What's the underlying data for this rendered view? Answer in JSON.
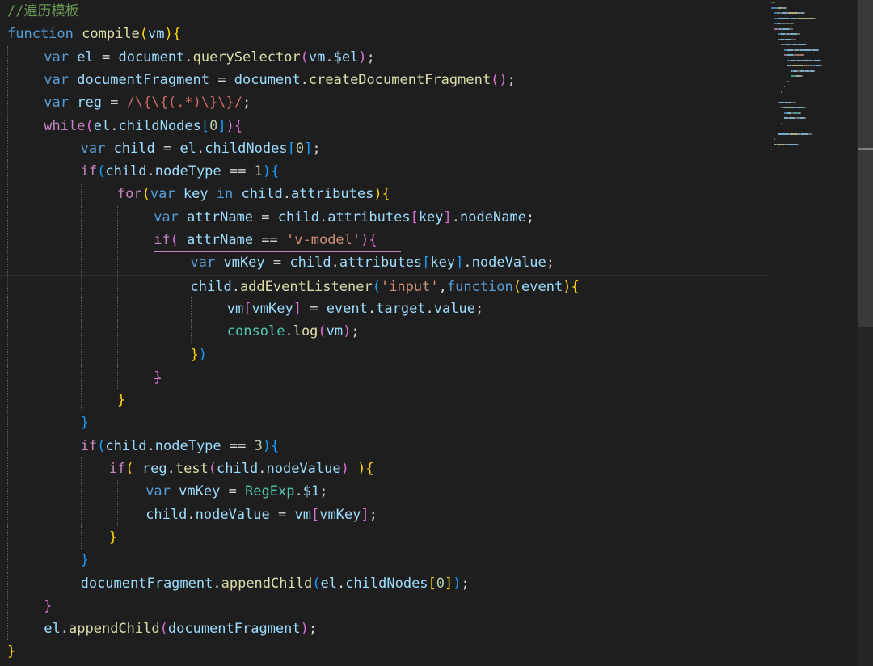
{
  "editor": {
    "lines": [
      {
        "indent": 0,
        "tokens": [
          [
            "c-comment",
            "//遍历模板"
          ]
        ]
      },
      {
        "indent": 0,
        "tokens": [
          [
            "c-keyword",
            "function"
          ],
          [
            "c-plain",
            " "
          ],
          [
            "c-func",
            "compile"
          ],
          [
            "b1",
            "("
          ],
          [
            "c-var",
            "vm"
          ],
          [
            "b1",
            ")"
          ],
          [
            "b1",
            "{"
          ]
        ]
      },
      {
        "indent": 1,
        "tokens": [
          [
            "c-keyword",
            "var"
          ],
          [
            "c-plain",
            " "
          ],
          [
            "c-var",
            "el"
          ],
          [
            "c-plain",
            " = "
          ],
          [
            "c-var",
            "document"
          ],
          [
            "c-plain",
            "."
          ],
          [
            "c-func",
            "querySelector"
          ],
          [
            "b2",
            "("
          ],
          [
            "c-var",
            "vm"
          ],
          [
            "c-plain",
            "."
          ],
          [
            "c-var",
            "$el"
          ],
          [
            "b2",
            ")"
          ],
          [
            "c-plain",
            ";"
          ]
        ]
      },
      {
        "indent": 1,
        "tokens": [
          [
            "c-keyword",
            "var"
          ],
          [
            "c-plain",
            " "
          ],
          [
            "c-var",
            "documentFragment"
          ],
          [
            "c-plain",
            " = "
          ],
          [
            "c-var",
            "document"
          ],
          [
            "c-plain",
            "."
          ],
          [
            "c-func",
            "createDocumentFragment"
          ],
          [
            "b2",
            "("
          ],
          [
            "b2",
            ")"
          ],
          [
            "c-plain",
            ";"
          ]
        ]
      },
      {
        "indent": 1,
        "tokens": [
          [
            "c-keyword",
            "var"
          ],
          [
            "c-plain",
            " "
          ],
          [
            "c-var",
            "reg"
          ],
          [
            "c-plain",
            " = "
          ],
          [
            "c-regex",
            "/\\{\\{(.*)\\}\\}/"
          ],
          [
            "c-plain",
            ";"
          ]
        ]
      },
      {
        "indent": 1,
        "tokens": [
          [
            "c-control",
            "while"
          ],
          [
            "b2",
            "("
          ],
          [
            "c-var",
            "el"
          ],
          [
            "c-plain",
            "."
          ],
          [
            "c-var",
            "childNodes"
          ],
          [
            "b3",
            "["
          ],
          [
            "c-number",
            "0"
          ],
          [
            "b3",
            "]"
          ],
          [
            "b2",
            ")"
          ],
          [
            "b2",
            "{"
          ]
        ]
      },
      {
        "indent": 2,
        "tokens": [
          [
            "c-keyword",
            "var"
          ],
          [
            "c-plain",
            " "
          ],
          [
            "c-var",
            "child"
          ],
          [
            "c-plain",
            " = "
          ],
          [
            "c-var",
            "el"
          ],
          [
            "c-plain",
            "."
          ],
          [
            "c-var",
            "childNodes"
          ],
          [
            "b3",
            "["
          ],
          [
            "c-number",
            "0"
          ],
          [
            "b3",
            "]"
          ],
          [
            "c-plain",
            ";"
          ]
        ]
      },
      {
        "indent": 2,
        "tokens": [
          [
            "c-control",
            "if"
          ],
          [
            "b3",
            "("
          ],
          [
            "c-var",
            "child"
          ],
          [
            "c-plain",
            "."
          ],
          [
            "c-var",
            "nodeType"
          ],
          [
            "c-plain",
            " == "
          ],
          [
            "c-number",
            "1"
          ],
          [
            "b3",
            ")"
          ],
          [
            "b3",
            "{"
          ]
        ]
      },
      {
        "indent": 3,
        "tokens": [
          [
            "c-control",
            "for"
          ],
          [
            "b1",
            "("
          ],
          [
            "c-keyword",
            "var"
          ],
          [
            "c-plain",
            " "
          ],
          [
            "c-var",
            "key"
          ],
          [
            "c-plain",
            " "
          ],
          [
            "c-keyword",
            "in"
          ],
          [
            "c-plain",
            " "
          ],
          [
            "c-var",
            "child"
          ],
          [
            "c-plain",
            "."
          ],
          [
            "c-var",
            "attributes"
          ],
          [
            "b1",
            ")"
          ],
          [
            "b1",
            "{"
          ]
        ]
      },
      {
        "indent": 4,
        "tokens": [
          [
            "c-keyword",
            "var"
          ],
          [
            "c-plain",
            " "
          ],
          [
            "c-var",
            "attrName"
          ],
          [
            "c-plain",
            " = "
          ],
          [
            "c-var",
            "child"
          ],
          [
            "c-plain",
            "."
          ],
          [
            "c-var",
            "attributes"
          ],
          [
            "b2",
            "["
          ],
          [
            "c-var",
            "key"
          ],
          [
            "b2",
            "]"
          ],
          [
            "c-plain",
            "."
          ],
          [
            "c-var",
            "nodeName"
          ],
          [
            "c-plain",
            ";"
          ]
        ]
      },
      {
        "indent": 4,
        "tokens": [
          [
            "c-control",
            "if"
          ],
          [
            "b2",
            "("
          ],
          [
            "c-plain",
            " "
          ],
          [
            "c-var",
            "attrName"
          ],
          [
            "c-plain",
            " == "
          ],
          [
            "c-string",
            "'v-model'"
          ],
          [
            "b2",
            ")"
          ],
          [
            "b2",
            "{"
          ]
        ]
      },
      {
        "indent": 5,
        "tokens": [
          [
            "c-keyword",
            "var"
          ],
          [
            "c-plain",
            " "
          ],
          [
            "c-var",
            "vmKey"
          ],
          [
            "c-plain",
            " = "
          ],
          [
            "c-var",
            "child"
          ],
          [
            "c-plain",
            "."
          ],
          [
            "c-var",
            "attributes"
          ],
          [
            "b3",
            "["
          ],
          [
            "c-var",
            "key"
          ],
          [
            "b3",
            "]"
          ],
          [
            "c-plain",
            "."
          ],
          [
            "c-var",
            "nodeValue"
          ],
          [
            "c-plain",
            ";"
          ]
        ]
      },
      {
        "indent": 5,
        "current": true,
        "tokens": [
          [
            "c-var",
            "child"
          ],
          [
            "c-plain",
            "."
          ],
          [
            "c-func",
            "addEventListener"
          ],
          [
            "b3",
            "("
          ],
          [
            "c-string",
            "'input'"
          ],
          [
            "c-plain",
            ","
          ],
          [
            "c-keyword",
            "function"
          ],
          [
            "b1",
            "("
          ],
          [
            "c-var",
            "event"
          ],
          [
            "b1",
            ")"
          ],
          [
            "b1",
            "{"
          ]
        ]
      },
      {
        "indent": 6,
        "tokens": [
          [
            "c-var",
            "vm"
          ],
          [
            "b2",
            "["
          ],
          [
            "c-var",
            "vmKey"
          ],
          [
            "b2",
            "]"
          ],
          [
            "c-plain",
            " = "
          ],
          [
            "c-var",
            "event"
          ],
          [
            "c-plain",
            "."
          ],
          [
            "c-var",
            "target"
          ],
          [
            "c-plain",
            "."
          ],
          [
            "c-var",
            "value"
          ],
          [
            "c-plain",
            ";"
          ]
        ]
      },
      {
        "indent": 6,
        "tokens": [
          [
            "c-class",
            "console"
          ],
          [
            "c-plain",
            "."
          ],
          [
            "c-func",
            "log"
          ],
          [
            "b2",
            "("
          ],
          [
            "c-var",
            "vm"
          ],
          [
            "b2",
            ")"
          ],
          [
            "c-plain",
            ";"
          ]
        ]
      },
      {
        "indent": 5,
        "tokens": [
          [
            "b1",
            "}"
          ],
          [
            "b3",
            ")"
          ]
        ]
      },
      {
        "indent": 4,
        "tokens": [
          [
            "b2",
            "}"
          ]
        ]
      },
      {
        "indent": 3,
        "tokens": [
          [
            "b1",
            "}"
          ]
        ]
      },
      {
        "indent": 2,
        "tokens": [
          [
            "b3",
            "}"
          ]
        ]
      },
      {
        "indent": 2,
        "tokens": [
          [
            "c-control",
            "if"
          ],
          [
            "b3",
            "("
          ],
          [
            "c-var",
            "child"
          ],
          [
            "c-plain",
            "."
          ],
          [
            "c-var",
            "nodeType"
          ],
          [
            "c-plain",
            " == "
          ],
          [
            "c-number",
            "3"
          ],
          [
            "b3",
            ")"
          ],
          [
            "b3",
            "{"
          ]
        ]
      },
      {
        "indent": 3,
        "offset": -10,
        "tokens": [
          [
            "c-control",
            "if"
          ],
          [
            "b1",
            "("
          ],
          [
            "c-plain",
            " "
          ],
          [
            "c-var",
            "reg"
          ],
          [
            "c-plain",
            "."
          ],
          [
            "c-func",
            "test"
          ],
          [
            "b2",
            "("
          ],
          [
            "c-var",
            "child"
          ],
          [
            "c-plain",
            "."
          ],
          [
            "c-var",
            "nodeValue"
          ],
          [
            "b2",
            ")"
          ],
          [
            "c-plain",
            " "
          ],
          [
            "b1",
            ")"
          ],
          [
            "b1",
            "{"
          ]
        ]
      },
      {
        "indent": 4,
        "offset": -10,
        "tokens": [
          [
            "c-keyword",
            "var"
          ],
          [
            "c-plain",
            " "
          ],
          [
            "c-var",
            "vmKey"
          ],
          [
            "c-plain",
            " = "
          ],
          [
            "c-class",
            "RegExp"
          ],
          [
            "c-plain",
            "."
          ],
          [
            "c-var",
            "$1"
          ],
          [
            "c-plain",
            ";"
          ]
        ]
      },
      {
        "indent": 4,
        "offset": -10,
        "tokens": [
          [
            "c-var",
            "child"
          ],
          [
            "c-plain",
            "."
          ],
          [
            "c-var",
            "nodeValue"
          ],
          [
            "c-plain",
            " = "
          ],
          [
            "c-var",
            "vm"
          ],
          [
            "b2",
            "["
          ],
          [
            "c-var",
            "vmKey"
          ],
          [
            "b2",
            "]"
          ],
          [
            "c-plain",
            ";"
          ]
        ]
      },
      {
        "indent": 3,
        "offset": -10,
        "tokens": [
          [
            "b1",
            "}"
          ]
        ]
      },
      {
        "indent": 2,
        "tokens": [
          [
            "b3",
            "}"
          ]
        ]
      },
      {
        "indent": 2,
        "tokens": [
          [
            "c-var",
            "documentFragment"
          ],
          [
            "c-plain",
            "."
          ],
          [
            "c-func",
            "appendChild"
          ],
          [
            "b3",
            "("
          ],
          [
            "c-var",
            "el"
          ],
          [
            "c-plain",
            "."
          ],
          [
            "c-var",
            "childNodes"
          ],
          [
            "b1",
            "["
          ],
          [
            "c-number",
            "0"
          ],
          [
            "b1",
            "]"
          ],
          [
            "b3",
            ")"
          ],
          [
            "c-plain",
            ";"
          ]
        ]
      },
      {
        "indent": 1,
        "tokens": [
          [
            "b2",
            "}"
          ]
        ]
      },
      {
        "indent": 1,
        "tokens": [
          [
            "c-var",
            "el"
          ],
          [
            "c-plain",
            "."
          ],
          [
            "c-func",
            "appendChild"
          ],
          [
            "b2",
            "("
          ],
          [
            "c-var",
            "documentFragment"
          ],
          [
            "b2",
            ")"
          ],
          [
            "c-plain",
            ";"
          ]
        ]
      },
      {
        "indent": 0,
        "tokens": [
          [
            "b1",
            "}"
          ]
        ]
      }
    ]
  },
  "colors": {
    "background": "#1e1e1e",
    "keyword": "#569cd6",
    "control": "#c586c0",
    "function": "#dcdcaa",
    "variable": "#9cdcfe",
    "string": "#ce9178",
    "comment": "#6a9955"
  }
}
